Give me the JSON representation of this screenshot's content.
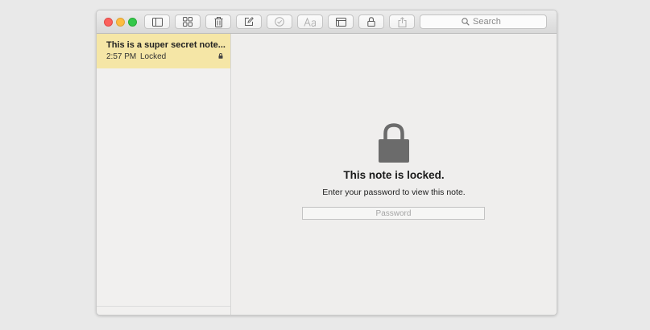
{
  "toolbar": {
    "search_placeholder": "Search"
  },
  "sidebar": {
    "notes": [
      {
        "title": "This is a super secret note...",
        "time": "2:57 PM",
        "status": "Locked"
      }
    ]
  },
  "main": {
    "locked_title": "This note is locked.",
    "locked_message": "Enter your password to view this note.",
    "password_placeholder": "Password"
  },
  "colors": {
    "selected_note_bg": "#f5e6a6",
    "lock_icon": "#6b6b6b"
  }
}
